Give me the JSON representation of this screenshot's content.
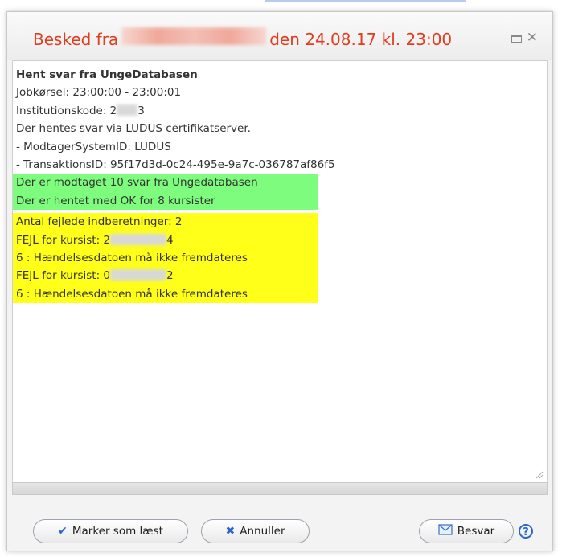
{
  "dialog": {
    "title_prefix": "Besked fra",
    "title_suffix": "den 24.08.17 kl. 23:00"
  },
  "message": {
    "heading": "Hent svar fra UngeDatabasen",
    "lines": [
      "Jobkørsel: 23:00:00 - 23:00:01",
      "Institutionskode: 2",
      "3",
      "Der hentes svar via LUDUS certifikatserver.",
      "- ModtagerSystemID: LUDUS",
      "- TransaktionsID: 95f17d3d-0c24-495e-9a7c-036787af86f5"
    ],
    "green_lines": [
      "Der er modtaget 10 svar fra Ungedatabasen",
      "Der er hentet med OK for 8 kursister"
    ],
    "yellow": {
      "failed": "Antal fejlede indberetninger: 2",
      "err1_prefix": "FEJL for kursist: 2",
      "err1_suffix": "4",
      "err1_reason": "6 : Hændelsesdatoen må ikke fremdateres",
      "err2_prefix": "FEJL for kursist: 0",
      "err2_suffix": "2",
      "err2_reason": "6 : Hændelsesdatoen må ikke fremdateres"
    }
  },
  "footer": {
    "mark_read": "Marker som læst",
    "cancel": "Annuller",
    "reply": "Besvar",
    "help": "?"
  },
  "colors": {
    "title": "#e03c1e",
    "green_highlight": "#7dfc7d",
    "yellow_highlight": "#ffff1a",
    "accent": "#2a67c8"
  }
}
